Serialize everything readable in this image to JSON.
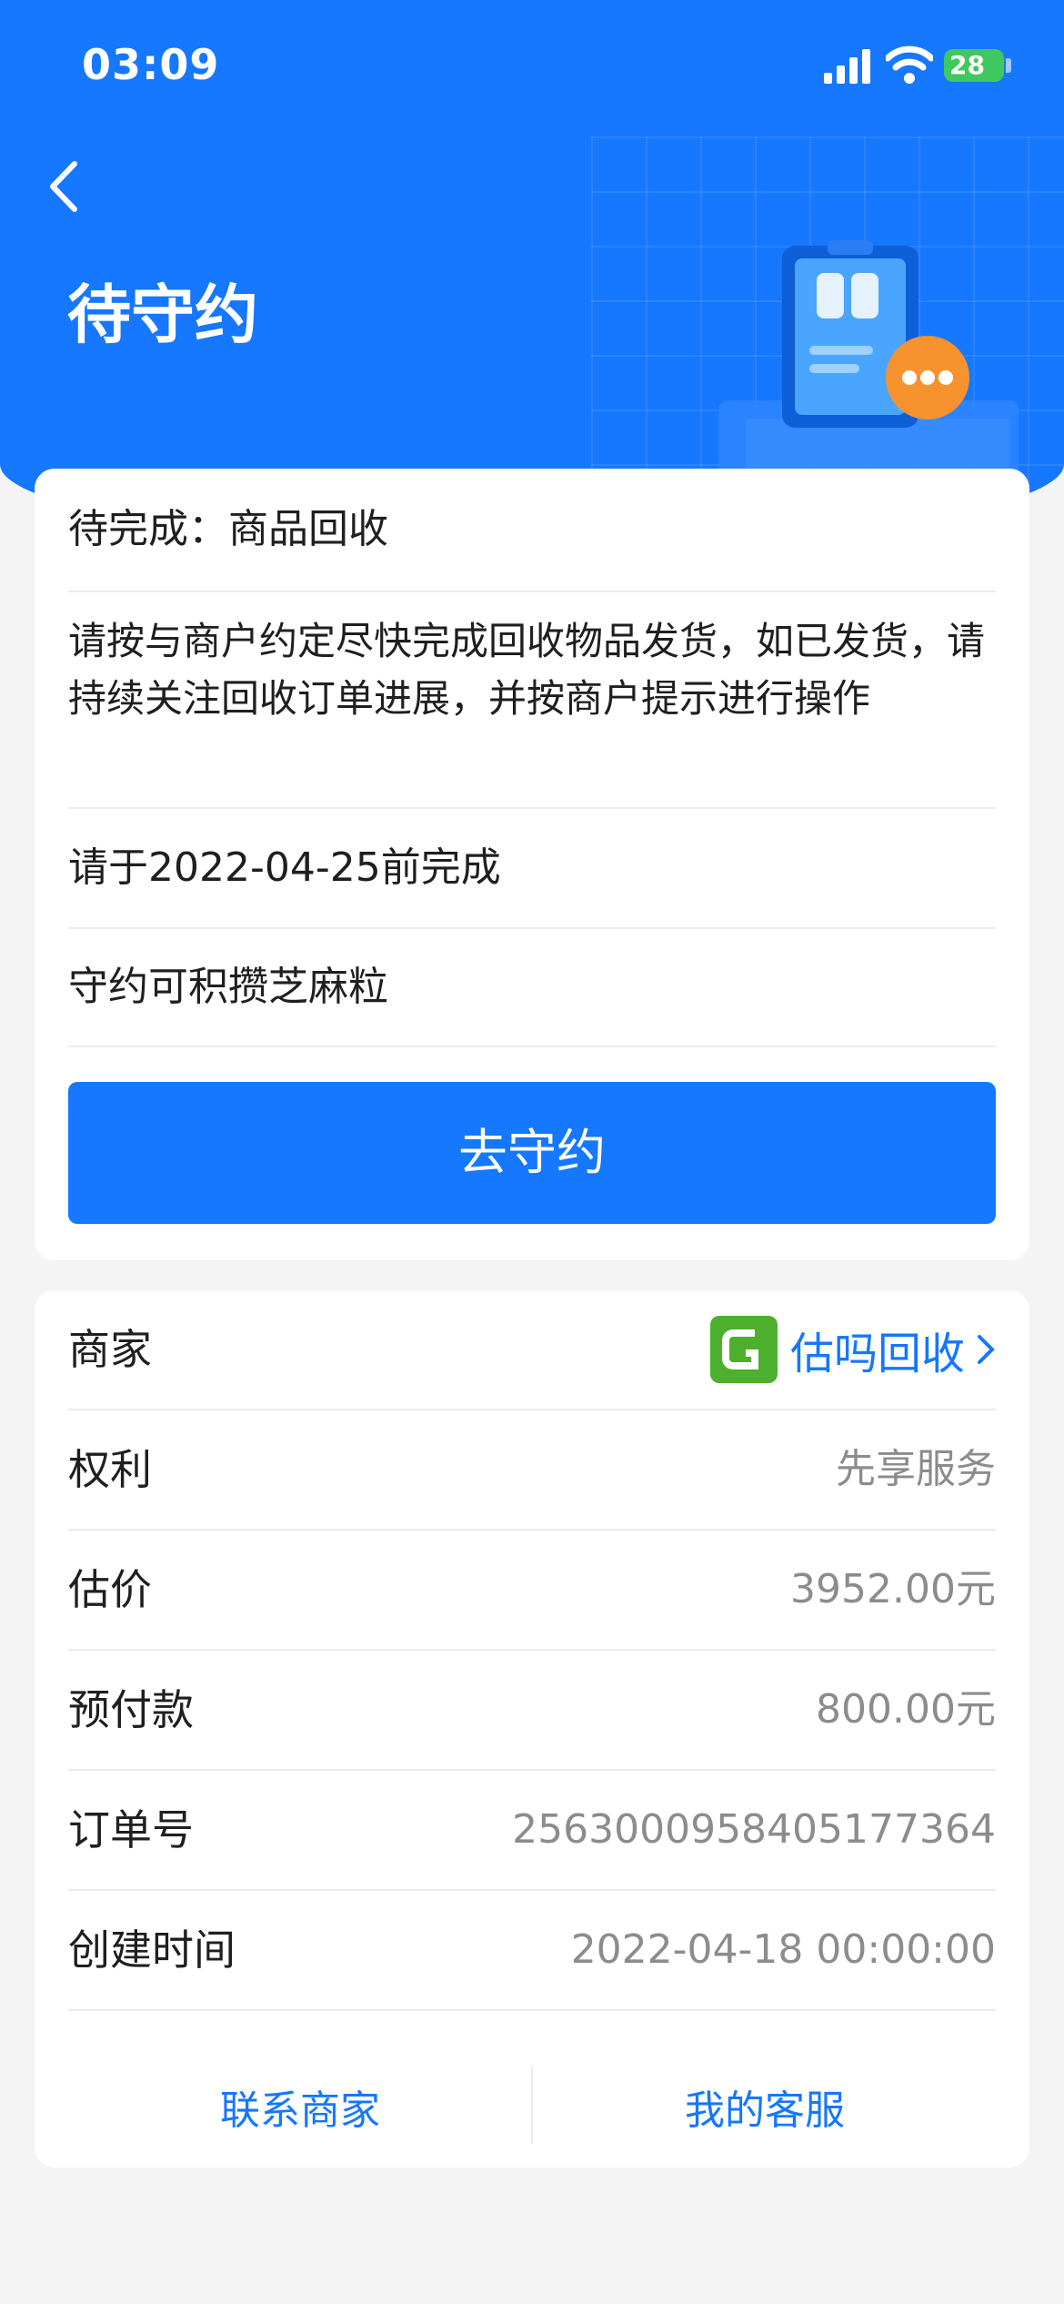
{
  "status_bar": {
    "time": "03:09",
    "battery": "28"
  },
  "header": {
    "title": "待守约"
  },
  "task_card": {
    "pending_label": "待完成：商品回收",
    "instruction": "请按与商户约定尽快完成回收物品发货，如已发货，请持续关注回收订单进展，并按商户提示进行操作",
    "deadline": "请于2022-04-25前完成",
    "reward": "守约可积攒芝麻粒",
    "action_button": "去守约"
  },
  "details": {
    "merchant": {
      "label": "商家",
      "name": "估吗回收",
      "logo_letter": "G"
    },
    "rights": {
      "label": "权利",
      "value": "先享服务"
    },
    "estimate": {
      "label": "估价",
      "value": "3952.00元"
    },
    "prepay": {
      "label": "预付款",
      "value": "800.00元"
    },
    "order_no": {
      "label": "订单号",
      "value": "2563000958405177364"
    },
    "created": {
      "label": "创建时间",
      "value": "2022-04-18 00:00:00"
    }
  },
  "footer": {
    "contact_merchant": "联系商家",
    "my_service": "我的客服"
  },
  "colors": {
    "primary": "#1677ff",
    "merchant_logo": "#4caf2e",
    "badge": "#f7932f"
  }
}
